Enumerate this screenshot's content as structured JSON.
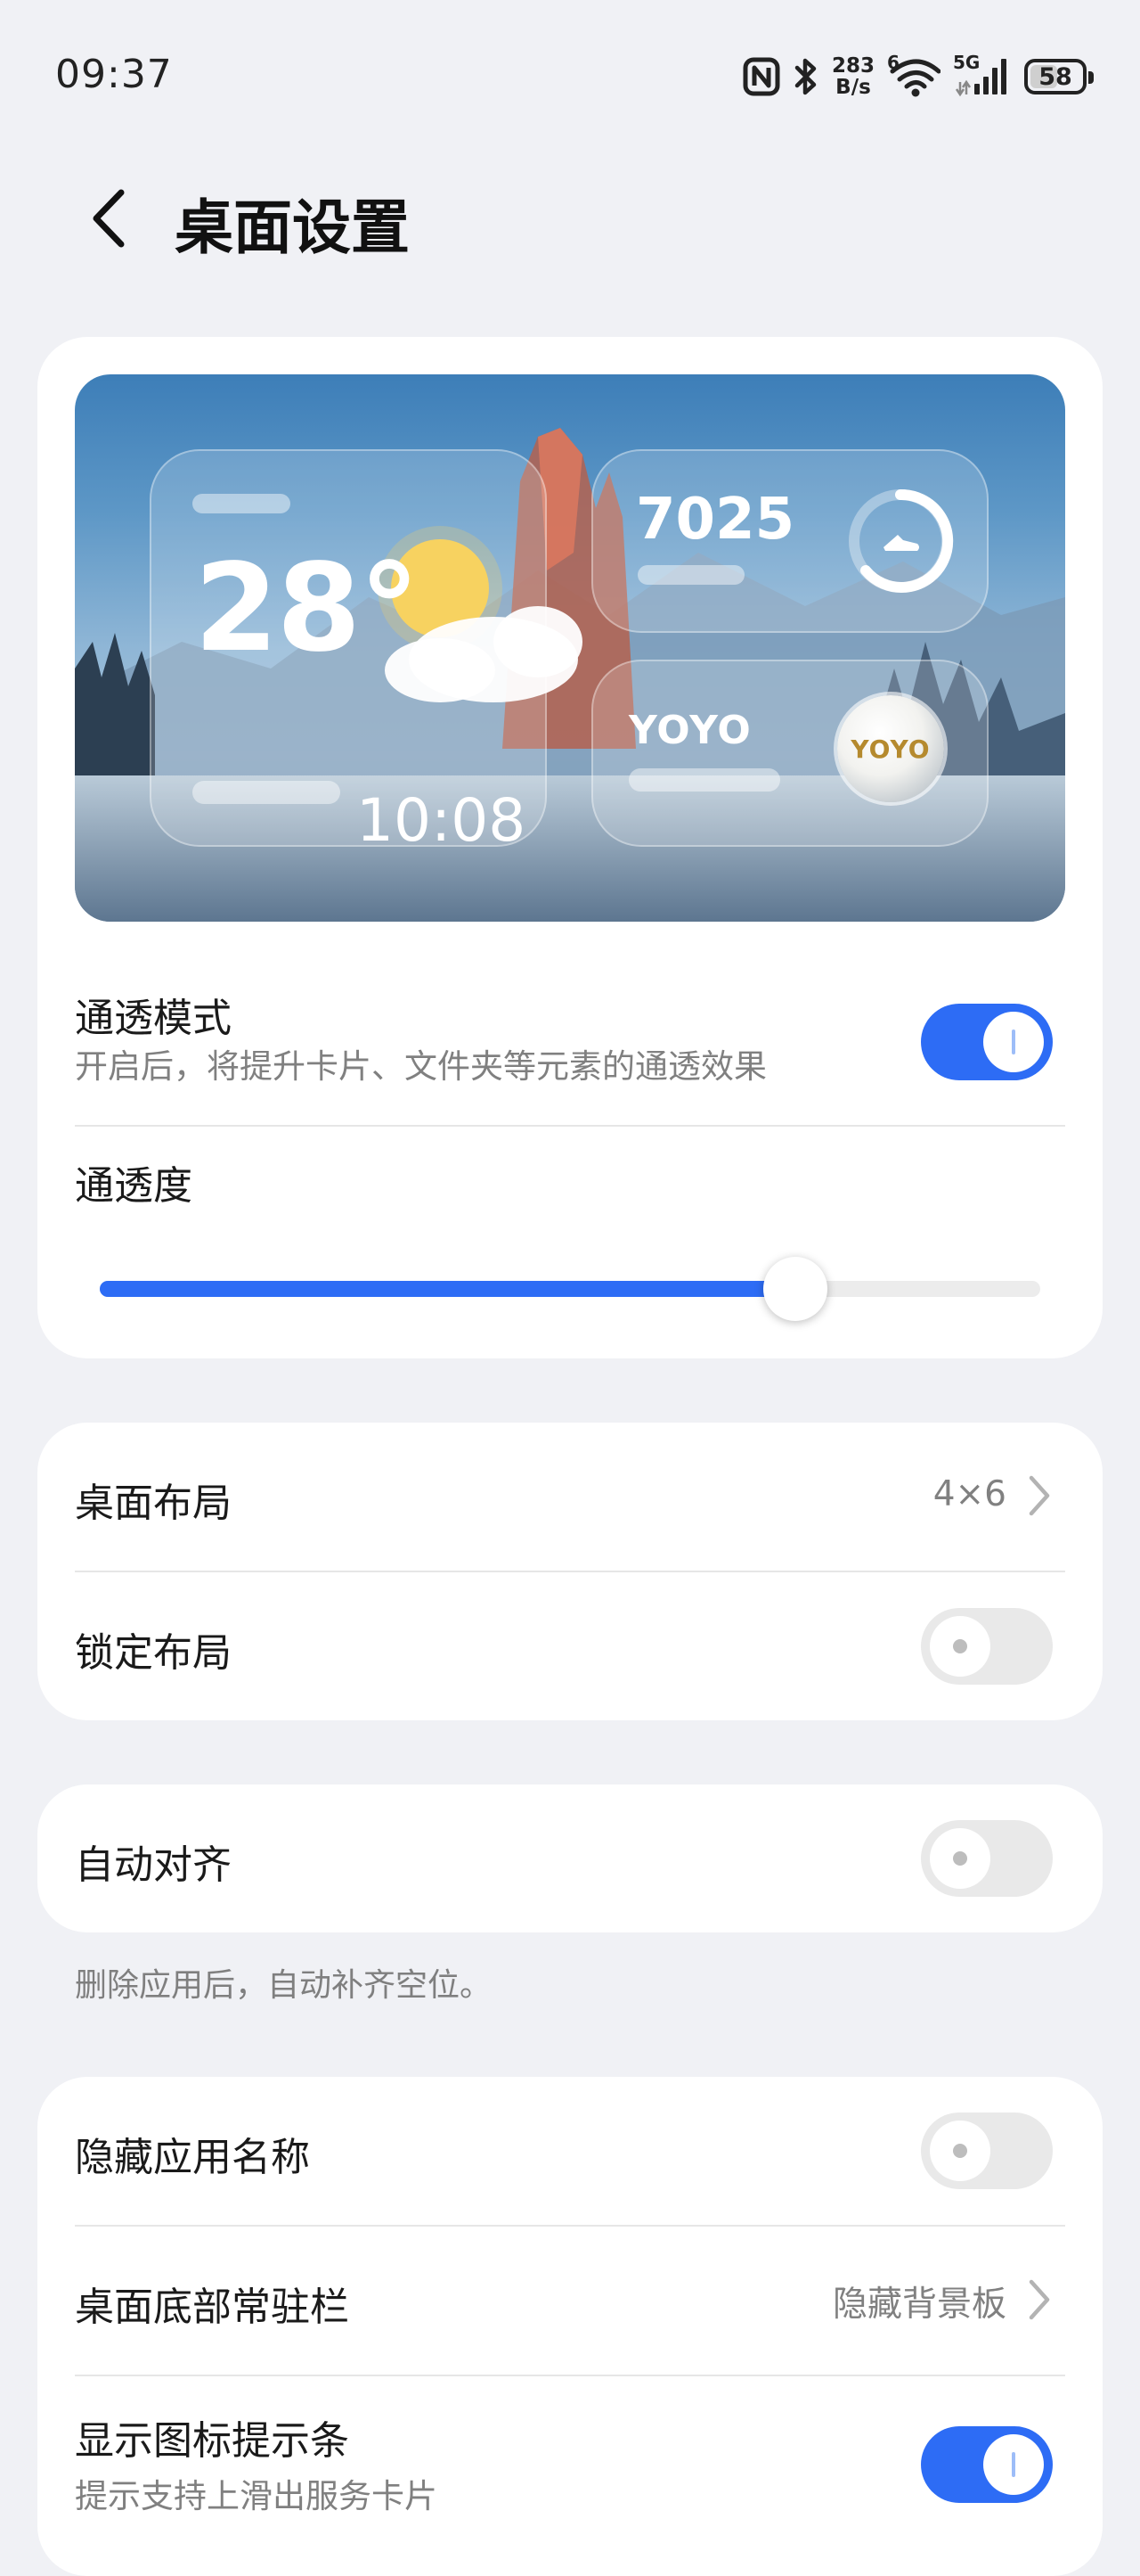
{
  "status_bar": {
    "time": "09:37",
    "net_speed_value": "283",
    "net_speed_unit": "B/s",
    "wifi_badge": "6",
    "cell_badge": "5G",
    "battery_level": "58",
    "icons": [
      "nfc-icon",
      "bluetooth-icon",
      "wifi-icon",
      "signal-icon",
      "battery-icon"
    ]
  },
  "header": {
    "title": "桌面设置",
    "back_icon": "chevron-left-icon"
  },
  "preview": {
    "weather_temp": "28°",
    "weather_time": "10:08",
    "weather_icon": "partly-sunny-icon",
    "steps_value": "7025",
    "steps_icon": "running-shoe-ring-icon",
    "yoyo_label": "YOYO",
    "yoyo_orb_label": "YOYO"
  },
  "transparency": {
    "mode_label": "通透模式",
    "mode_desc": "开启后，将提升卡片、文件夹等元素的通透效果",
    "mode_on": true,
    "level_label": "通透度",
    "level_fraction": 0.74
  },
  "layout": {
    "desktop_layout_label": "桌面布局",
    "desktop_layout_value": "4×6",
    "lock_layout_label": "锁定布局",
    "lock_layout_on": false
  },
  "align": {
    "auto_align_label": "自动对齐",
    "auto_align_on": false,
    "auto_align_note": "删除应用后，自动补齐空位。"
  },
  "display": {
    "hide_names_label": "隐藏应用名称",
    "hide_names_on": false,
    "dock_label": "桌面底部常驻栏",
    "dock_value": "隐藏背景板",
    "icon_hint_label": "显示图标提示条",
    "icon_hint_desc": "提示支持上滑出服务卡片",
    "icon_hint_on": true
  },
  "colors": {
    "accent": "#2d6cf5",
    "background": "#f0f1f5",
    "card": "#ffffff",
    "toggle_off": "#e9e9e9"
  }
}
